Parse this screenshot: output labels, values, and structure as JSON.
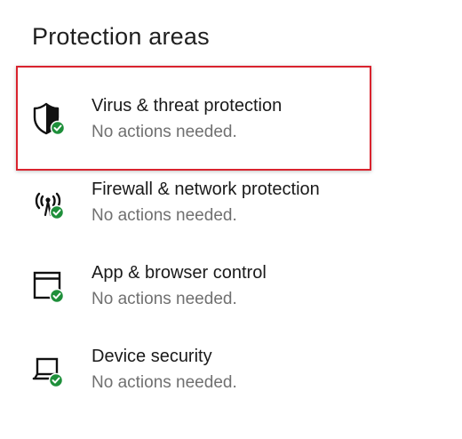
{
  "section": {
    "title": "Protection areas"
  },
  "items": [
    {
      "title": "Virus & threat protection",
      "status": "No actions needed.",
      "icon": "shield-check-icon"
    },
    {
      "title": "Firewall & network protection",
      "status": "No actions needed.",
      "icon": "wifi-antenna-check-icon"
    },
    {
      "title": "App & browser control",
      "status": "No actions needed.",
      "icon": "browser-window-check-icon"
    },
    {
      "title": "Device security",
      "status": "No actions needed.",
      "icon": "laptop-check-icon"
    }
  ],
  "colors": {
    "highlight": "#d9232e",
    "status_ok": "#1e8f3a",
    "secondary_text": "#707070"
  }
}
